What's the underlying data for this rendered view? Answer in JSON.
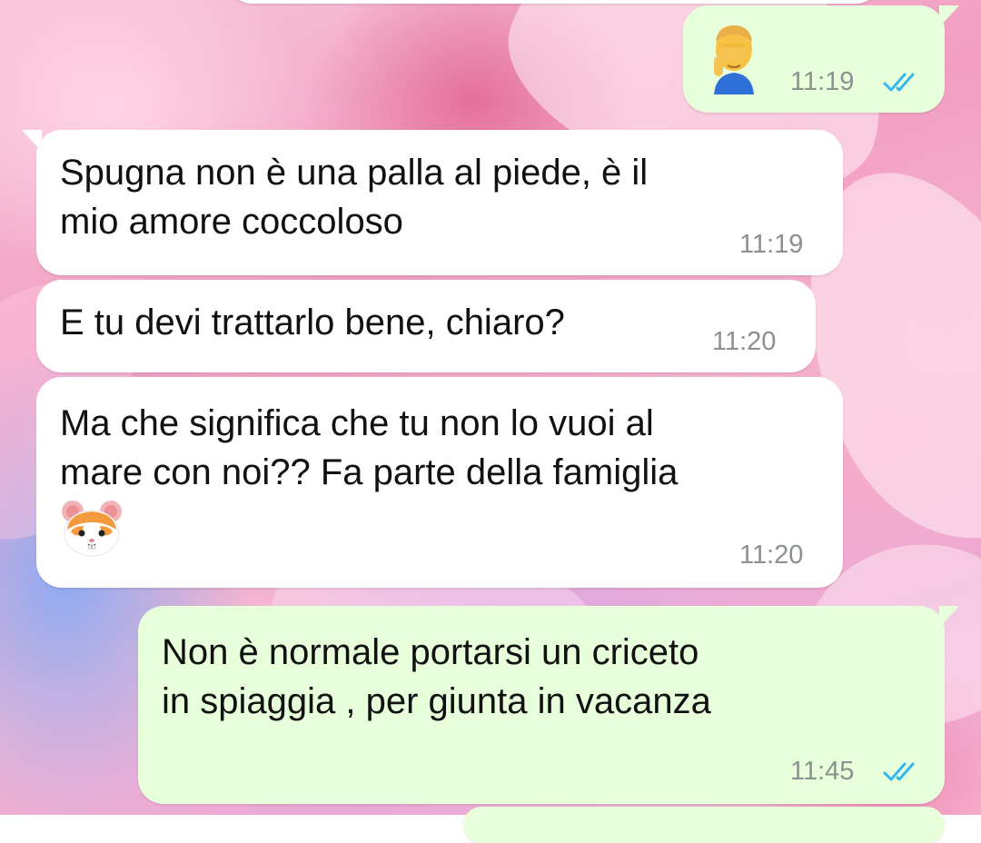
{
  "conversation": {
    "messages": [
      {
        "direction": "outgoing",
        "text": "",
        "emoji": "face-palm-emoji",
        "time": "11:19",
        "read_receipt": "read-double-check"
      },
      {
        "direction": "incoming",
        "text": "Spugna non è una palla al piede, è il\nmio amore coccoloso",
        "time": "11:19"
      },
      {
        "direction": "incoming",
        "text": "E tu devi trattarlo bene, chiaro?",
        "time": "11:20"
      },
      {
        "direction": "incoming",
        "text": "Ma che significa che tu non lo vuoi al\nmare con noi?? Fa parte della famiglia",
        "emoji": "hamster-face-emoji",
        "time": "11:20"
      },
      {
        "direction": "outgoing",
        "text": "Non è normale portarsi un criceto\nin spiaggia , per giunta in vacanza",
        "time": "11:45",
        "read_receipt": "read-double-check"
      }
    ]
  },
  "colors": {
    "incoming_bubble": "#ffffff",
    "outgoing_bubble": "#e7ffdb",
    "read_tick": "#34b7f1",
    "time_text": "#8b918e"
  }
}
